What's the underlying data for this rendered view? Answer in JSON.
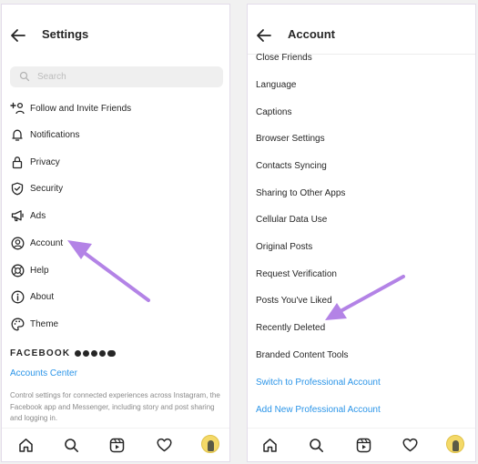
{
  "left_screen": {
    "title": "Settings",
    "search_placeholder": "Search",
    "menu_items": [
      {
        "label": "Follow and Invite Friends",
        "icon": "add-person-icon"
      },
      {
        "label": "Notifications",
        "icon": "bell-icon"
      },
      {
        "label": "Privacy",
        "icon": "lock-icon"
      },
      {
        "label": "Security",
        "icon": "shield-icon"
      },
      {
        "label": "Ads",
        "icon": "megaphone-icon"
      },
      {
        "label": "Account",
        "icon": "person-circle-icon"
      },
      {
        "label": "Help",
        "icon": "lifebuoy-icon"
      },
      {
        "label": "About",
        "icon": "info-icon"
      },
      {
        "label": "Theme",
        "icon": "palette-icon"
      }
    ],
    "facebook_heading": "FACEBOOK",
    "accounts_center": "Accounts Center",
    "accounts_center_description": "Control settings for connected experiences across Instagram, the Facebook app and Messenger, including story and post sharing and logging in."
  },
  "right_screen": {
    "title": "Account",
    "items": [
      {
        "label": "Close Friends"
      },
      {
        "label": "Language"
      },
      {
        "label": "Captions"
      },
      {
        "label": "Browser Settings"
      },
      {
        "label": "Contacts Syncing"
      },
      {
        "label": "Sharing to Other Apps"
      },
      {
        "label": "Cellular Data Use"
      },
      {
        "label": "Original Posts"
      },
      {
        "label": "Request Verification"
      },
      {
        "label": "Posts You've Liked"
      },
      {
        "label": "Recently Deleted"
      },
      {
        "label": "Branded Content Tools"
      }
    ],
    "links": [
      {
        "label": "Switch to Professional Account"
      },
      {
        "label": "Add New Professional Account"
      }
    ]
  },
  "bottom_nav": [
    "home-icon",
    "search-icon",
    "reels-icon",
    "heart-icon",
    "profile-avatar"
  ],
  "colors": {
    "link": "#2b95e8",
    "annotation_arrow": "#b383e6",
    "text": "#262626",
    "search_bg": "#efefef"
  }
}
